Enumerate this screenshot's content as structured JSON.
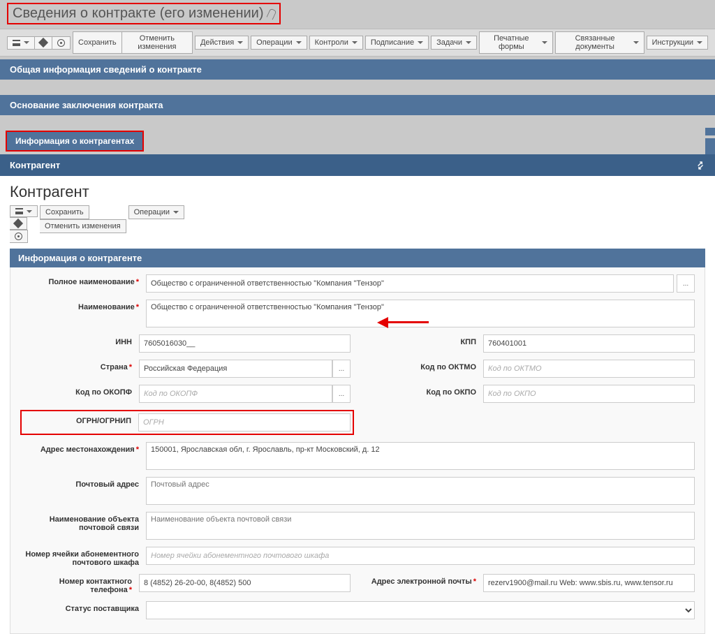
{
  "header": {
    "title": "Сведения о контракте (его изменении)"
  },
  "toolbar1": {
    "save": "Сохранить",
    "cancel": "Отменить изменения",
    "actions": "Действия",
    "operations": "Операции",
    "controls": "Контроли",
    "signing": "Подписание",
    "tasks": "Задачи",
    "printForms": "Печатные формы",
    "relatedDocs": "Связанные документы",
    "instructions": "Инструкции"
  },
  "sections": {
    "general": "Общая информация сведений о контракте",
    "basis": "Основание заключения контракта",
    "contragentsInfo": "Информация о контрагентах",
    "contragentPanel": "Контрагент"
  },
  "panel": {
    "title": "Контрагент",
    "toolbar": {
      "save": "Сохранить",
      "cancel": "Отменить изменения",
      "operations": "Операции"
    },
    "subheader": "Информация о контрагенте"
  },
  "form": {
    "fullName": {
      "label": "Полное наименование",
      "value": "Общество с ограниченной ответственностью \"Компания \"Тензор\""
    },
    "name": {
      "label": "Наименование",
      "value": "Общество с ограниченной ответственностью \"Компания \"Тензор\""
    },
    "inn": {
      "label": "ИНН",
      "value": "7605016030__"
    },
    "kpp": {
      "label": "КПП",
      "value": "760401001"
    },
    "country": {
      "label": "Страна",
      "value": "Российская Федерация"
    },
    "oktmo": {
      "label": "Код по ОКТМО",
      "placeholder": "Код по ОКТМО"
    },
    "okopf": {
      "label": "Код по ОКОПФ",
      "placeholder": "Код по ОКОПФ"
    },
    "okpo": {
      "label": "Код по ОКПО",
      "placeholder": "Код по ОКПО"
    },
    "ogrn": {
      "label": "ОГРН/ОГРНИП",
      "placeholder": "ОГРН"
    },
    "address": {
      "label": "Адрес местонахождения",
      "value": "150001, Ярославская обл, г. Ярославль, пр-кт Московский, д. 12"
    },
    "postAddress": {
      "label": "Почтовый адрес",
      "placeholder": "Почтовый адрес"
    },
    "postObjName": {
      "label": "Наименование объекта почтовой связи",
      "placeholder": "Наименование объекта почтовой связи"
    },
    "boxNumber": {
      "label": "Номер ячейки абонементного почтового шкафа",
      "placeholder": "Номер ячейки абонементного почтового шкафа"
    },
    "phone": {
      "label": "Номер контактного телефона",
      "value": "8 (4852) 26-20-00, 8(4852) 500"
    },
    "email": {
      "label": "Адрес электронной почты",
      "value": "rezerv1900@mail.ru Web: www.sbis.ru, www.tensor.ru"
    },
    "supplierStatus": {
      "label": "Статус поставщика"
    }
  }
}
